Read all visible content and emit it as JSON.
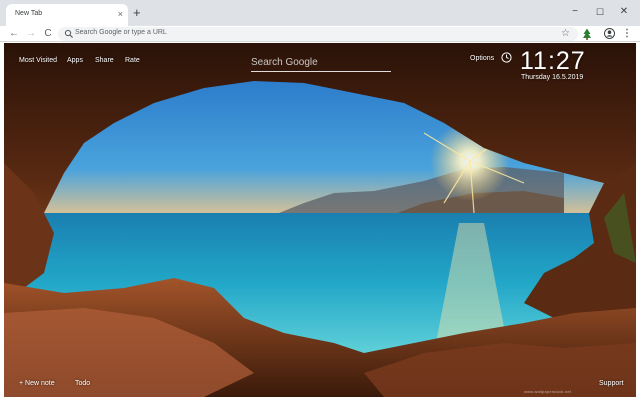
{
  "browser": {
    "tab": {
      "title": "New Tab",
      "close_glyph": "×"
    },
    "new_tab_glyph": "+",
    "window_controls": {
      "minimize": "−",
      "maximize": "☐",
      "close": "✕"
    },
    "nav": {
      "back": "←",
      "forward": "→",
      "reload": "C"
    },
    "omnibox": {
      "placeholder": "Search Google or type a URL",
      "icon": "search-icon"
    },
    "toolbar_icons": {
      "bookmark": "☆",
      "extension": "tree-icon",
      "account": "account-icon",
      "menu": "⋮"
    }
  },
  "newtab": {
    "top_links": [
      "Most Visited",
      "Apps",
      "Share",
      "Rate"
    ],
    "search_placeholder": "Search Google",
    "options_label": "Options",
    "clock": {
      "time": "11:27",
      "date": "Thursday  16.5.2019"
    },
    "bottom_links": {
      "new_note": "+ New note",
      "todo": "Todo"
    },
    "support_label": "Support",
    "watermark": "www.wallpaperstock.net"
  },
  "colors": {
    "tabstrip": "#dee1e6",
    "omnibox": "#f1f3f4",
    "sky": "#2f7fcf",
    "sea": "#27a2c3",
    "rock": "#7a3b1a"
  }
}
